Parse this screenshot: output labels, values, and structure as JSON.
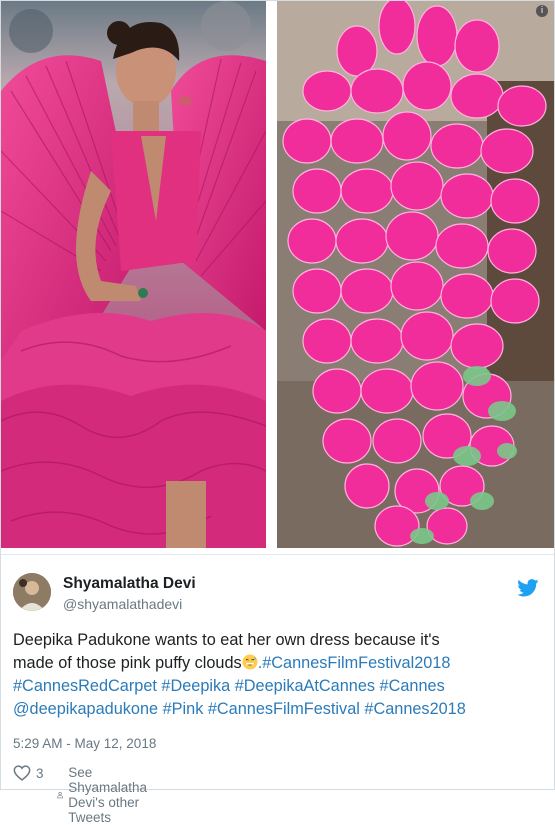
{
  "tweet": {
    "author_name": "Shyamalatha Devi",
    "author_handle": "@shyamalathadevi",
    "text_lines": [
      "Deepika Padukone wants to eat her own dress because it's",
      "made of those pink puffy clouds",
      "#CannesRedCarpet #Deepika #DeepikaAtCannes #Cannes",
      "@deepikapadukone #Pink #CannesFilmFestival #Cannes2018"
    ],
    "line2_hashtag": ".#CannesFilmFestival2018",
    "timestamp": "5:29 AM - May 12, 2018",
    "like_count": "3",
    "other_tweets_label": "See Shyamalatha Devi's other Tweets"
  },
  "photos": {
    "left_icon": "dress-photo",
    "right_icon": "cotton-candy-photo",
    "corner_badge": "i"
  },
  "colors": {
    "link": "#2b7bb9",
    "text": "#1c2022",
    "muted": "#697882",
    "twitter_blue": "#1da1f2",
    "pink": "#e8328c"
  },
  "icons": [
    "twitter-bird-icon",
    "heart-icon",
    "person-icon",
    "grin-sweat-emoji-icon",
    "info-icon"
  ]
}
